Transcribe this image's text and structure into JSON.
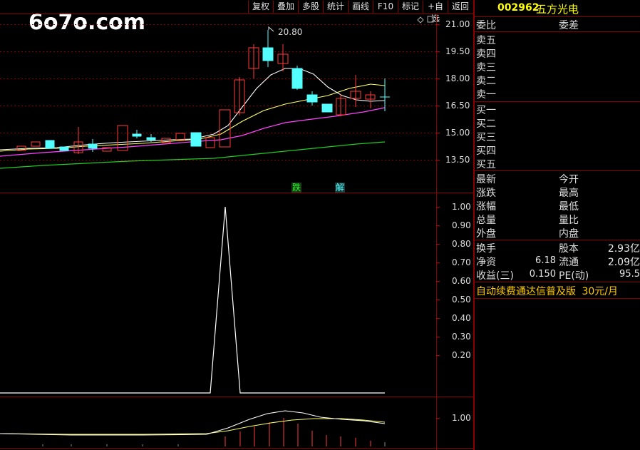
{
  "watermark": "6o7o.com",
  "toolbar": {
    "items": [
      "复权",
      "叠加",
      "多股",
      "统计",
      "画线",
      "F10",
      "标记",
      "+自选",
      "返回"
    ]
  },
  "main_chart": {
    "y_ticks": [
      "21.00",
      "19.50",
      "18.00",
      "16.50",
      "15.00",
      "13.50"
    ],
    "high_label": "20.80",
    "signals": [
      "跌",
      "解"
    ]
  },
  "indicator_chart": {
    "y_ticks": [
      "1.00",
      "0.90",
      "0.80",
      "0.70",
      "0.60",
      "0.50",
      "0.40",
      "0.30",
      "0.20"
    ]
  },
  "volume_chart": {
    "y_ticks": [
      "1.00"
    ]
  },
  "stock": {
    "code": "002962",
    "name": "五方光电"
  },
  "panel": {
    "weibi": "委比",
    "weicha": "委差",
    "sells": [
      "卖五",
      "卖四",
      "卖三",
      "卖二",
      "卖一"
    ],
    "buys": [
      "买一",
      "买二",
      "买三",
      "买四",
      "买五"
    ],
    "quote_left": [
      "最新",
      "涨跌",
      "涨幅",
      "总量",
      "外盘"
    ],
    "quote_right": [
      "今开",
      "最高",
      "最低",
      "量比",
      "内盘"
    ],
    "stats": [
      {
        "l1": "换手",
        "v1": "",
        "l2": "股本",
        "v2": "2.93亿"
      },
      {
        "l1": "净资",
        "v1": "6.18",
        "l2": "流通",
        "v2": "2.09亿"
      },
      {
        "l1": "收益(三)",
        "v1": "0.150",
        "l2": "PE(动)",
        "v2": "95.5"
      }
    ],
    "ad_text": "自动续费通达信普及版",
    "ad_price": "30元/月"
  },
  "colors": {
    "border": "#8b0000",
    "up": "#ff3b3b",
    "down": "#54ffff",
    "ma_white": "#ffffff",
    "ma_yellow": "#ffff66",
    "ma_magenta": "#ff44ff",
    "ma_green": "#22cc22",
    "code": "#ffff00"
  }
}
